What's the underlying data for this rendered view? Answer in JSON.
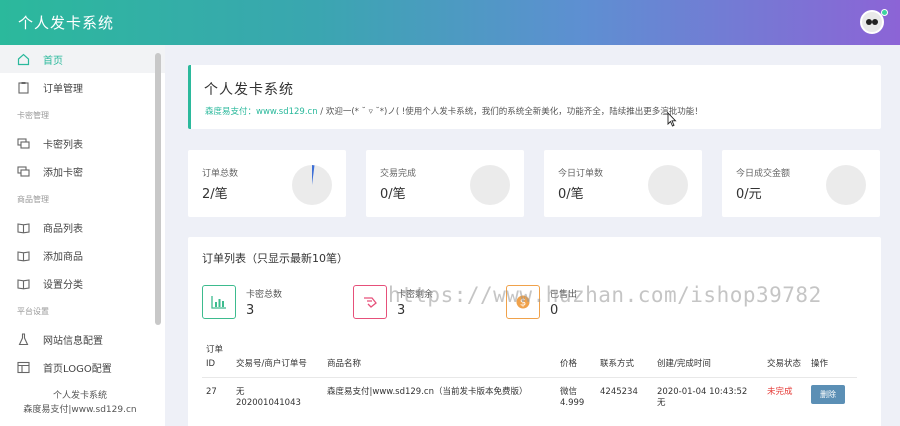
{
  "header": {
    "title": "个人发卡系统"
  },
  "sidebar": {
    "items": [
      {
        "label": "首页",
        "icon": "home-icon",
        "active": true
      },
      {
        "label": "订单管理",
        "icon": "clipboard-icon"
      }
    ],
    "group1": "卡密管理",
    "group1_items": [
      {
        "label": "卡密列表",
        "icon": "cards-icon"
      },
      {
        "label": "添加卡密",
        "icon": "cards-icon"
      }
    ],
    "group2": "商品管理",
    "group2_items": [
      {
        "label": "商品列表",
        "icon": "book-icon"
      },
      {
        "label": "添加商品",
        "icon": "book-icon"
      },
      {
        "label": "设置分类",
        "icon": "book-icon"
      }
    ],
    "group3": "平台设置",
    "group3_items": [
      {
        "label": "网站信息配置",
        "icon": "flask-icon"
      },
      {
        "label": "首页LOGO配置",
        "icon": "layout-icon"
      }
    ],
    "footer_line1": "个人发卡系统",
    "footer_line2": "森度易支付|www.sd129.cn"
  },
  "main": {
    "title": "个人发卡系统",
    "subtitle_link": "森度易支付：www.sd129.cn",
    "subtitle_text": " / 欢迎一(* ˘ ▿ ˘*)ノ( !使用个人发卡系统，我们的系统全新美化，功能齐全，陆续推出更多渲批功能！",
    "stats": [
      {
        "label": "订单总数",
        "value": "2/笔"
      },
      {
        "label": "交易完成",
        "value": "0/笔"
      },
      {
        "label": "今日订单数",
        "value": "0/笔"
      },
      {
        "label": "今日成交金额",
        "value": "0/元"
      }
    ],
    "orders_title": "订单列表（只显示最新10笔）",
    "mini_stats": [
      {
        "label": "卡密总数",
        "value": "3",
        "color": "#3dbb8e"
      },
      {
        "label": "卡密剩余",
        "value": "3",
        "color": "#e6507a"
      },
      {
        "label": "已售出",
        "value": "0",
        "color": "#f0a24b"
      }
    ],
    "table": {
      "headers": [
        "订单ID",
        "交易号/商户订单号",
        "商品名称",
        "价格",
        "联系方式",
        "创建/完成时间",
        "交易状态",
        "操作"
      ],
      "rows": [
        {
          "id": "27",
          "trade_no": "无",
          "order_no": "202001041043",
          "product": "森度易支付|www.sd129.cn（当前发卡版本免费版）",
          "price": "微信",
          "price2": "4.999",
          "contact": "4245234",
          "time": "2020-01-04 10:43:52",
          "time2": "无",
          "status": "未完成",
          "action": "删除"
        }
      ]
    }
  },
  "watermark": "https://www.huzhan.com/ishop39782",
  "colors": {
    "accent": "#2bb99c",
    "danger": "#e53935",
    "button": "#5b8fb5"
  }
}
